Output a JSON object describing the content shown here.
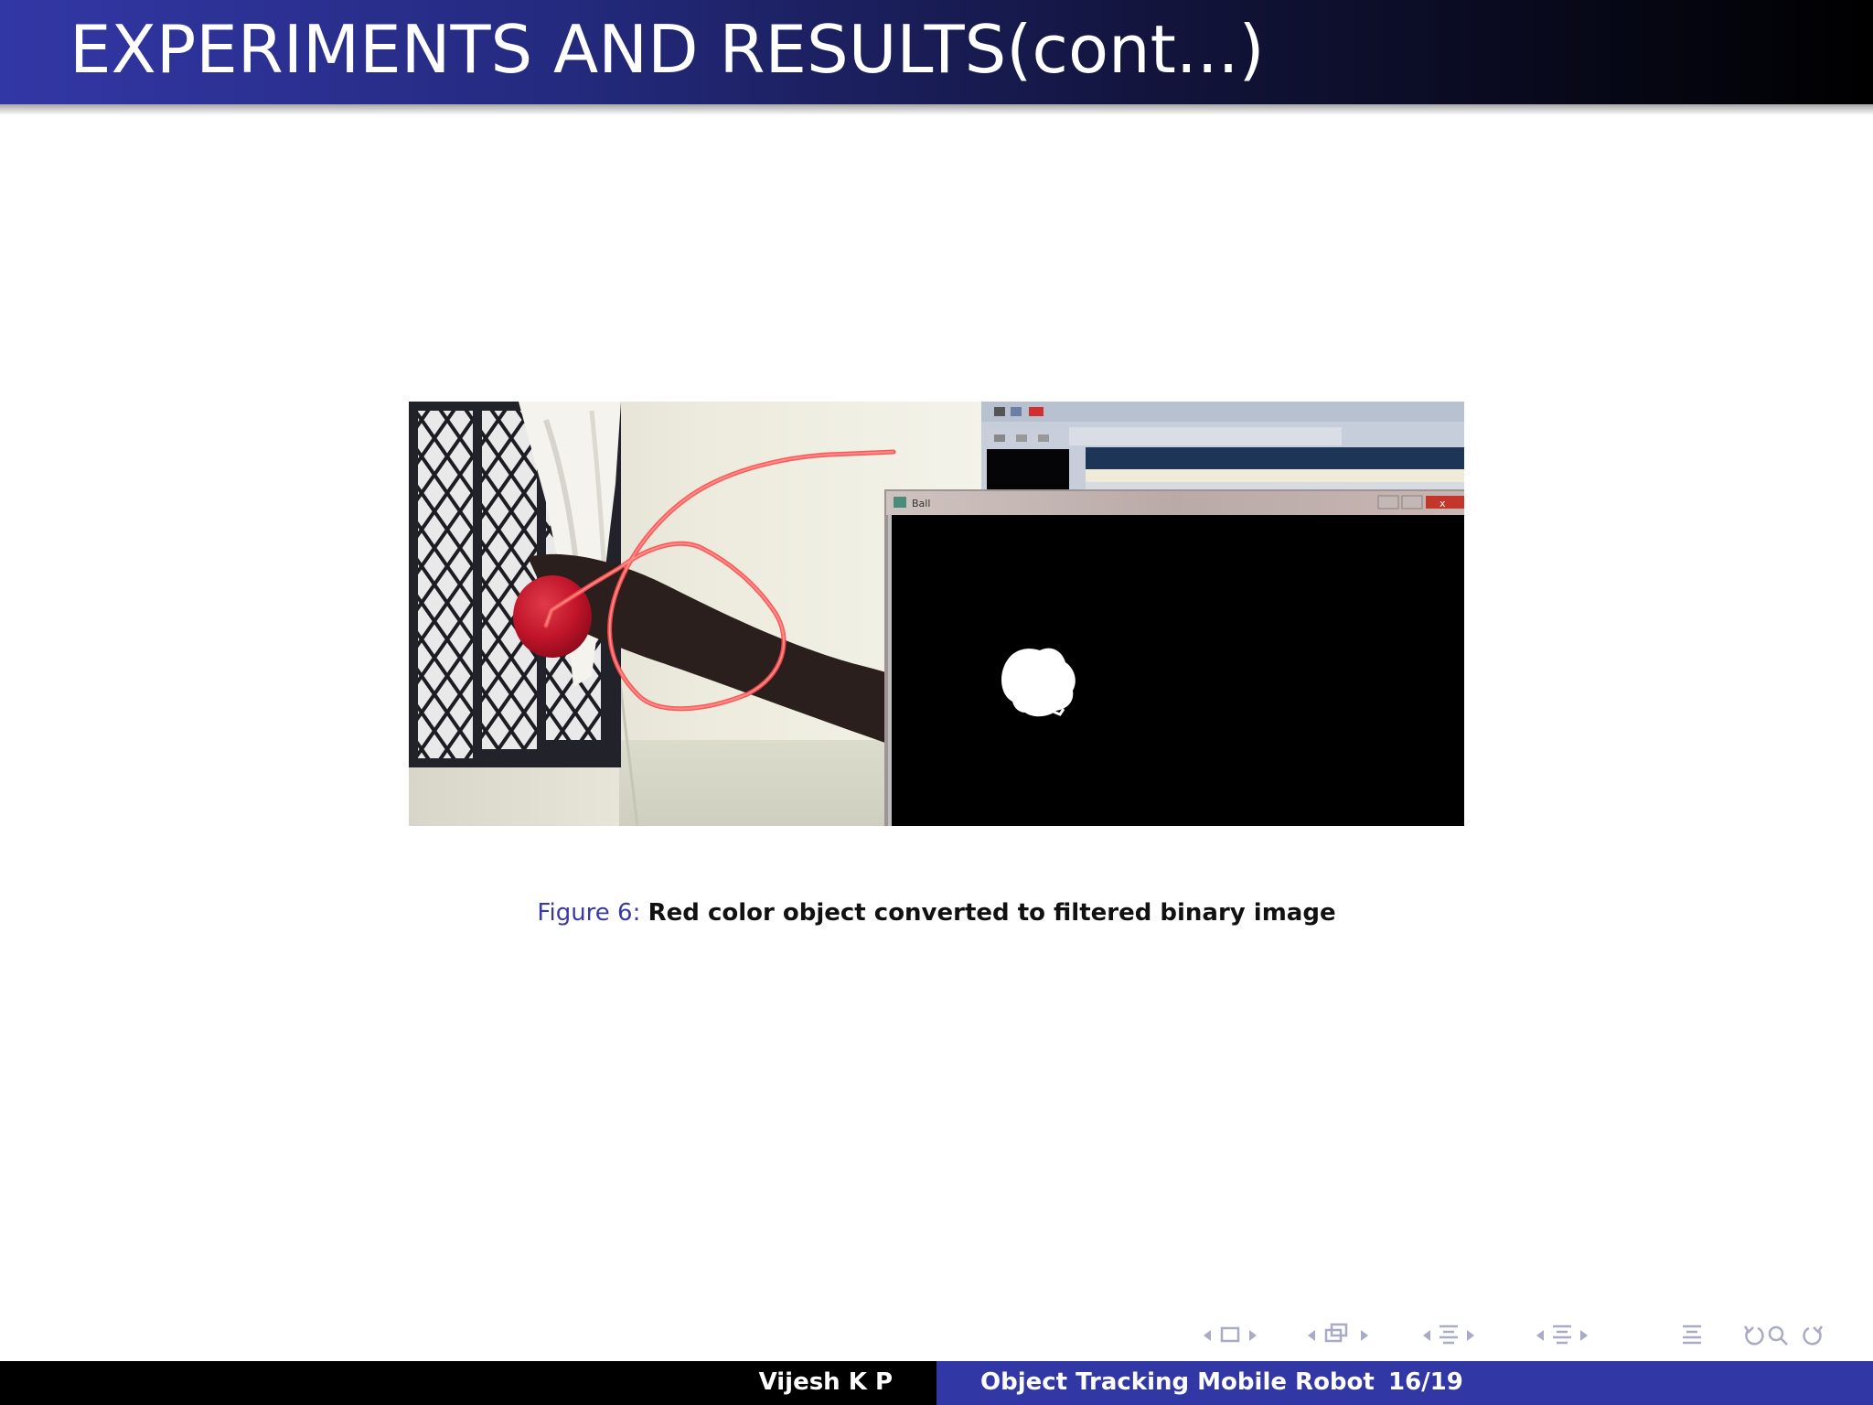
{
  "slide": {
    "title": "EXPERIMENTS AND RESULTS(cont...)"
  },
  "figure": {
    "label": "Figure 6:",
    "caption": "Red color object converted to filtered binary image",
    "window_title": "Ball"
  },
  "footer": {
    "author": "Vijesh K P",
    "talk_title": "Object Tracking Mobile Robot",
    "page": "16/19"
  },
  "colors": {
    "title_bar_start": "#3237a6",
    "title_bar_end": "#000000",
    "footer_left": "#000000",
    "footer_right": "#3237a6",
    "caption_label": "#3a3aa6",
    "nav_icons": "#a9a9c8"
  },
  "nav_icons": [
    "arrow-left-icon",
    "frame-icon",
    "arrow-right-icon",
    "arrow-left-icon",
    "subsection-icon",
    "arrow-right-icon",
    "arrow-left-icon",
    "section-icon",
    "arrow-right-icon",
    "arrow-left-icon",
    "section-icon",
    "arrow-right-icon",
    "align-icon",
    "undo-icon",
    "search-icon",
    "redo-icon"
  ]
}
